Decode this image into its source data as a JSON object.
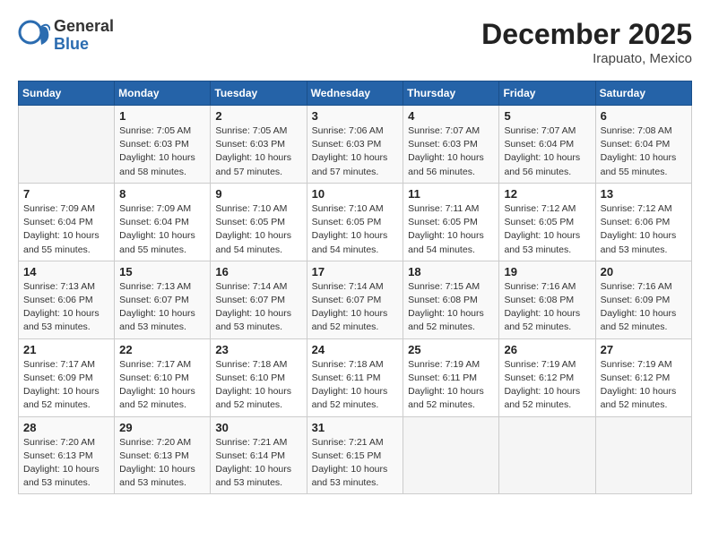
{
  "header": {
    "logo_general": "General",
    "logo_blue": "Blue",
    "month_title": "December 2025",
    "location": "Irapuato, Mexico"
  },
  "weekdays": [
    "Sunday",
    "Monday",
    "Tuesday",
    "Wednesday",
    "Thursday",
    "Friday",
    "Saturday"
  ],
  "weeks": [
    [
      {
        "day": "",
        "info": ""
      },
      {
        "day": "1",
        "info": "Sunrise: 7:05 AM\nSunset: 6:03 PM\nDaylight: 10 hours\nand 58 minutes."
      },
      {
        "day": "2",
        "info": "Sunrise: 7:05 AM\nSunset: 6:03 PM\nDaylight: 10 hours\nand 57 minutes."
      },
      {
        "day": "3",
        "info": "Sunrise: 7:06 AM\nSunset: 6:03 PM\nDaylight: 10 hours\nand 57 minutes."
      },
      {
        "day": "4",
        "info": "Sunrise: 7:07 AM\nSunset: 6:03 PM\nDaylight: 10 hours\nand 56 minutes."
      },
      {
        "day": "5",
        "info": "Sunrise: 7:07 AM\nSunset: 6:04 PM\nDaylight: 10 hours\nand 56 minutes."
      },
      {
        "day": "6",
        "info": "Sunrise: 7:08 AM\nSunset: 6:04 PM\nDaylight: 10 hours\nand 55 minutes."
      }
    ],
    [
      {
        "day": "7",
        "info": "Sunrise: 7:09 AM\nSunset: 6:04 PM\nDaylight: 10 hours\nand 55 minutes."
      },
      {
        "day": "8",
        "info": "Sunrise: 7:09 AM\nSunset: 6:04 PM\nDaylight: 10 hours\nand 55 minutes."
      },
      {
        "day": "9",
        "info": "Sunrise: 7:10 AM\nSunset: 6:05 PM\nDaylight: 10 hours\nand 54 minutes."
      },
      {
        "day": "10",
        "info": "Sunrise: 7:10 AM\nSunset: 6:05 PM\nDaylight: 10 hours\nand 54 minutes."
      },
      {
        "day": "11",
        "info": "Sunrise: 7:11 AM\nSunset: 6:05 PM\nDaylight: 10 hours\nand 54 minutes."
      },
      {
        "day": "12",
        "info": "Sunrise: 7:12 AM\nSunset: 6:05 PM\nDaylight: 10 hours\nand 53 minutes."
      },
      {
        "day": "13",
        "info": "Sunrise: 7:12 AM\nSunset: 6:06 PM\nDaylight: 10 hours\nand 53 minutes."
      }
    ],
    [
      {
        "day": "14",
        "info": "Sunrise: 7:13 AM\nSunset: 6:06 PM\nDaylight: 10 hours\nand 53 minutes."
      },
      {
        "day": "15",
        "info": "Sunrise: 7:13 AM\nSunset: 6:07 PM\nDaylight: 10 hours\nand 53 minutes."
      },
      {
        "day": "16",
        "info": "Sunrise: 7:14 AM\nSunset: 6:07 PM\nDaylight: 10 hours\nand 53 minutes."
      },
      {
        "day": "17",
        "info": "Sunrise: 7:14 AM\nSunset: 6:07 PM\nDaylight: 10 hours\nand 52 minutes."
      },
      {
        "day": "18",
        "info": "Sunrise: 7:15 AM\nSunset: 6:08 PM\nDaylight: 10 hours\nand 52 minutes."
      },
      {
        "day": "19",
        "info": "Sunrise: 7:16 AM\nSunset: 6:08 PM\nDaylight: 10 hours\nand 52 minutes."
      },
      {
        "day": "20",
        "info": "Sunrise: 7:16 AM\nSunset: 6:09 PM\nDaylight: 10 hours\nand 52 minutes."
      }
    ],
    [
      {
        "day": "21",
        "info": "Sunrise: 7:17 AM\nSunset: 6:09 PM\nDaylight: 10 hours\nand 52 minutes."
      },
      {
        "day": "22",
        "info": "Sunrise: 7:17 AM\nSunset: 6:10 PM\nDaylight: 10 hours\nand 52 minutes."
      },
      {
        "day": "23",
        "info": "Sunrise: 7:18 AM\nSunset: 6:10 PM\nDaylight: 10 hours\nand 52 minutes."
      },
      {
        "day": "24",
        "info": "Sunrise: 7:18 AM\nSunset: 6:11 PM\nDaylight: 10 hours\nand 52 minutes."
      },
      {
        "day": "25",
        "info": "Sunrise: 7:19 AM\nSunset: 6:11 PM\nDaylight: 10 hours\nand 52 minutes."
      },
      {
        "day": "26",
        "info": "Sunrise: 7:19 AM\nSunset: 6:12 PM\nDaylight: 10 hours\nand 52 minutes."
      },
      {
        "day": "27",
        "info": "Sunrise: 7:19 AM\nSunset: 6:12 PM\nDaylight: 10 hours\nand 52 minutes."
      }
    ],
    [
      {
        "day": "28",
        "info": "Sunrise: 7:20 AM\nSunset: 6:13 PM\nDaylight: 10 hours\nand 53 minutes."
      },
      {
        "day": "29",
        "info": "Sunrise: 7:20 AM\nSunset: 6:13 PM\nDaylight: 10 hours\nand 53 minutes."
      },
      {
        "day": "30",
        "info": "Sunrise: 7:21 AM\nSunset: 6:14 PM\nDaylight: 10 hours\nand 53 minutes."
      },
      {
        "day": "31",
        "info": "Sunrise: 7:21 AM\nSunset: 6:15 PM\nDaylight: 10 hours\nand 53 minutes."
      },
      {
        "day": "",
        "info": ""
      },
      {
        "day": "",
        "info": ""
      },
      {
        "day": "",
        "info": ""
      }
    ]
  ]
}
